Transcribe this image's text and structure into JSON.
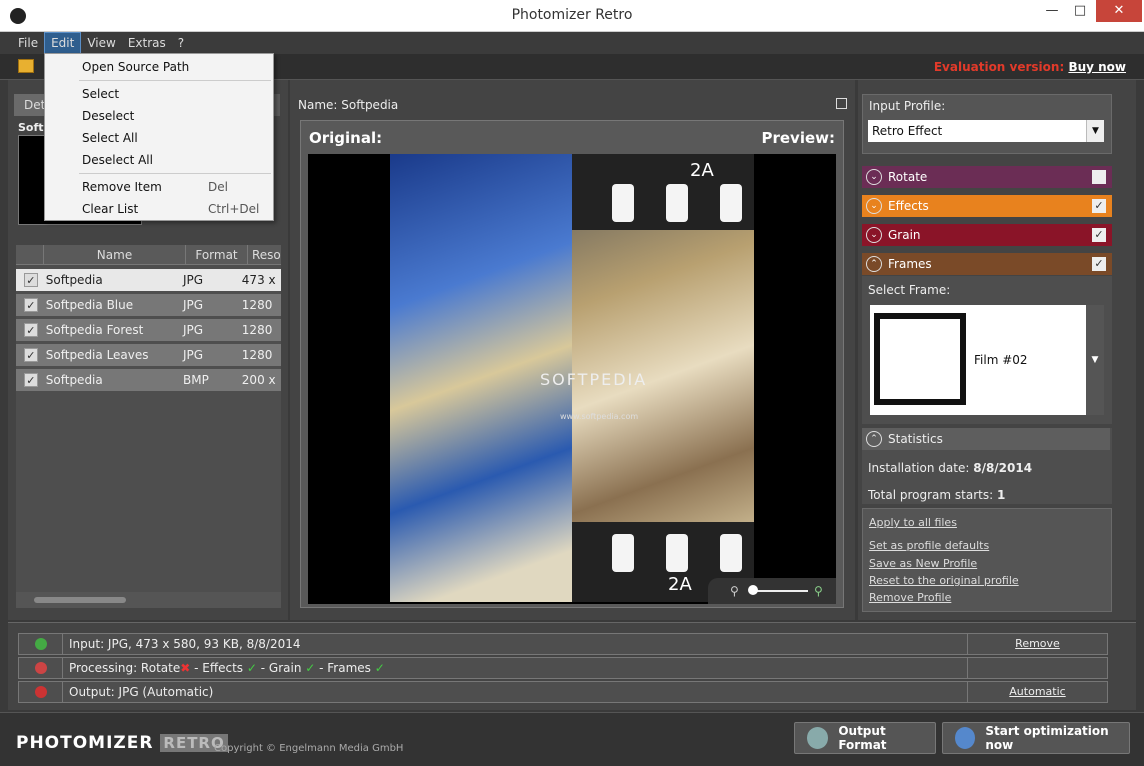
{
  "window": {
    "title": "Photomizer Retro",
    "minimize": "—",
    "maximize": "□",
    "close": "✕"
  },
  "menu": {
    "file": "File",
    "edit": "Edit",
    "view": "View",
    "extras": "Extras",
    "help": "?"
  },
  "toolbar": {
    "eval_label": "Evaluation version:",
    "buy_label": "Buy now"
  },
  "edit_menu": {
    "open_source_path": "Open Source Path",
    "select": "Select",
    "deselect": "Deselect",
    "select_all": "Select All",
    "deselect_all": "Deselect All",
    "remove_item": "Remove Item",
    "remove_item_shortcut": "Del",
    "clear_list": "Clear List",
    "clear_list_shortcut": "Ctrl+Del"
  },
  "left": {
    "tab_label": "Det",
    "thumb_label": "Softp",
    "columns": [
      "Name",
      "Format",
      "Reso"
    ],
    "files": [
      {
        "name": "Softpedia",
        "format": "JPG",
        "res": "473 x",
        "checked": true
      },
      {
        "name": "Softpedia Blue",
        "format": "JPG",
        "res": "1280",
        "checked": true
      },
      {
        "name": "Softpedia Forest",
        "format": "JPG",
        "res": "1280",
        "checked": true
      },
      {
        "name": "Softpedia Leaves",
        "format": "JPG",
        "res": "1280",
        "checked": true
      },
      {
        "name": "Softpedia",
        "format": "BMP",
        "res": "200 x",
        "checked": true
      }
    ]
  },
  "center": {
    "name_label": "Name: Softpedia",
    "original_label": "Original:",
    "preview_label": "Preview:",
    "film_label": "2A",
    "watermark": "SOFTPEDIA",
    "watermark_url": "www.softpedia.com"
  },
  "right": {
    "input_profile_label": "Input Profile:",
    "profile_value": "Retro Effect",
    "sections": [
      {
        "label": "Rotate",
        "color": "#6b2d55",
        "checked": false
      },
      {
        "label": "Effects",
        "color": "#e8821e",
        "checked": true
      },
      {
        "label": "Grain",
        "color": "#8a1428",
        "checked": true
      },
      {
        "label": "Frames",
        "color": "#7a4a28",
        "checked": true
      }
    ],
    "select_frame_label": "Select Frame:",
    "frame_value": "Film #02",
    "statistics_label": "Statistics",
    "install_date_label": "Installation date:",
    "install_date_value": "8/8/2014",
    "program_starts_label": "Total program starts:",
    "program_starts_value": "1",
    "links": [
      "Apply to all files",
      "Set as profile defaults",
      "Save as New Profile",
      "Reset to the original profile",
      "Remove Profile"
    ]
  },
  "info": {
    "input_text": "Input: JPG, 473 x 580, 93 KB, 8/8/2014",
    "input_action": "Remove",
    "processing_prefix": "Processing: Rotate",
    "processing_effects": " - Effects",
    "processing_grain": " - Grain",
    "processing_frames": " - Frames",
    "output_text": "Output: JPG (Automatic)",
    "output_action": "Automatic"
  },
  "footer": {
    "brand": "PHOTOMIZER",
    "brand_retro": "RETRO",
    "copyright": "Copyright © Engelmann Media GmbH",
    "output_format": "Output Format",
    "start_button": "Start optimization now"
  }
}
